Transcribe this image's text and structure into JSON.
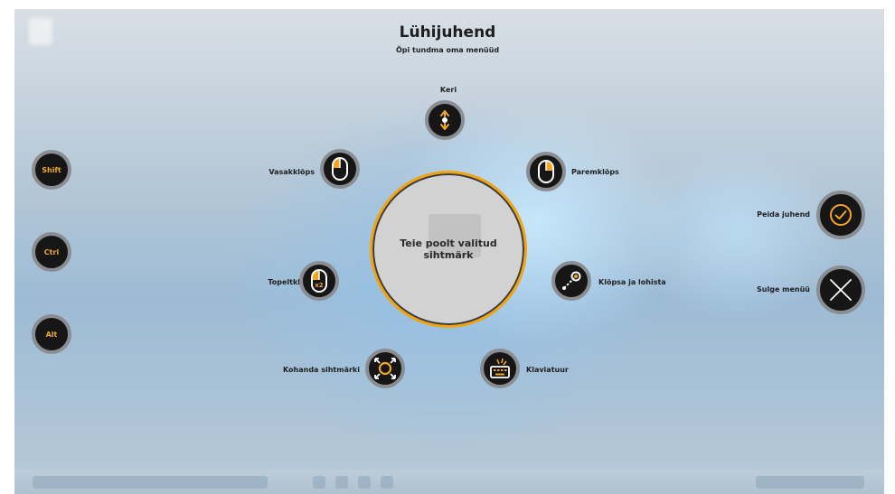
{
  "header": {
    "title": "Lühijuhend",
    "subtitle": "Õpi tundma oma menüüd"
  },
  "modifiers": [
    {
      "label": "Shift"
    },
    {
      "label": "Ctrl"
    },
    {
      "label": "Alt"
    }
  ],
  "actions": {
    "scroll": "Keri",
    "left_click": "Vasakklõps",
    "right_click": "Paremklõps",
    "double_click": "Topeltklõps",
    "drag": "Klõpsa ja lohista",
    "adjust_target": "Kohanda sihtmärki",
    "keyboard": "Klaviatuur"
  },
  "target": {
    "label": "Teie poolt valitud sihtmärk"
  },
  "side": {
    "hide_guide": "Peida juhend",
    "close_menu": "Sulge menüü"
  },
  "colors": {
    "accent": "#F4A620",
    "button_bg": "#161616",
    "button_ring": "#8A8D92"
  },
  "icons": {
    "double_click_badge": "x2"
  }
}
